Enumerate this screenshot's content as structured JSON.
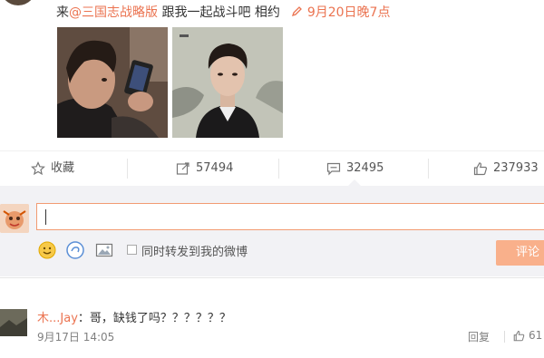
{
  "post": {
    "text_prefix": "来",
    "mention": "@三国志战略版",
    "text_suffix": " 跟我一起战斗吧 相约",
    "time": "9月20日晚7点"
  },
  "actions": {
    "favorite_label": "收藏",
    "repost_count": "57494",
    "comment_count": "32495",
    "like_count": "237933"
  },
  "composer": {
    "input_value": "",
    "sync_label": "同时转发到我的微博",
    "submit_label": "评论"
  },
  "comments": [
    {
      "user": "木...Jay",
      "separator": "：",
      "text": "哥，缺钱了吗？？？？？？",
      "time": "9月17日 14:05",
      "reply_label": "回复",
      "like_count": "61"
    }
  ],
  "colors": {
    "accent": "#eb7350",
    "input_border": "#f29b72",
    "submit_bg": "#f9b08b",
    "panel_bg": "#f2f2f5"
  }
}
